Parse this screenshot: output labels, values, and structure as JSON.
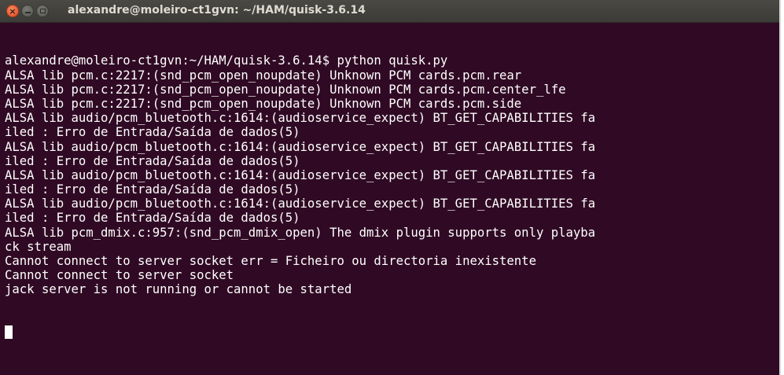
{
  "window": {
    "title": "alexandre@moleiro-ct1gvn: ~/HAM/quisk-3.6.14",
    "controls": {
      "close_icon": "close-icon",
      "minimize_icon": "minimize-icon",
      "maximize_icon": "maximize-icon",
      "close_glyph": "×"
    }
  },
  "terminal": {
    "lines": [
      "alexandre@moleiro-ct1gvn:~/HAM/quisk-3.6.14$ python quisk.py",
      "ALSA lib pcm.c:2217:(snd_pcm_open_noupdate) Unknown PCM cards.pcm.rear",
      "ALSA lib pcm.c:2217:(snd_pcm_open_noupdate) Unknown PCM cards.pcm.center_lfe",
      "ALSA lib pcm.c:2217:(snd_pcm_open_noupdate) Unknown PCM cards.pcm.side",
      "ALSA lib audio/pcm_bluetooth.c:1614:(audioservice_expect) BT_GET_CAPABILITIES fa",
      "iled : Erro de Entrada/Saída de dados(5)",
      "ALSA lib audio/pcm_bluetooth.c:1614:(audioservice_expect) BT_GET_CAPABILITIES fa",
      "iled : Erro de Entrada/Saída de dados(5)",
      "ALSA lib audio/pcm_bluetooth.c:1614:(audioservice_expect) BT_GET_CAPABILITIES fa",
      "iled : Erro de Entrada/Saída de dados(5)",
      "ALSA lib audio/pcm_bluetooth.c:1614:(audioservice_expect) BT_GET_CAPABILITIES fa",
      "iled : Erro de Entrada/Saída de dados(5)",
      "ALSA lib pcm_dmix.c:957:(snd_pcm_dmix_open) The dmix plugin supports only playba",
      "ck stream",
      "Cannot connect to server socket err = Ficheiro ou directoria inexistente",
      "Cannot connect to server socket",
      "jack server is not running or cannot be started"
    ],
    "colors": {
      "background": "#300a24",
      "foreground": "#ffffff"
    }
  }
}
